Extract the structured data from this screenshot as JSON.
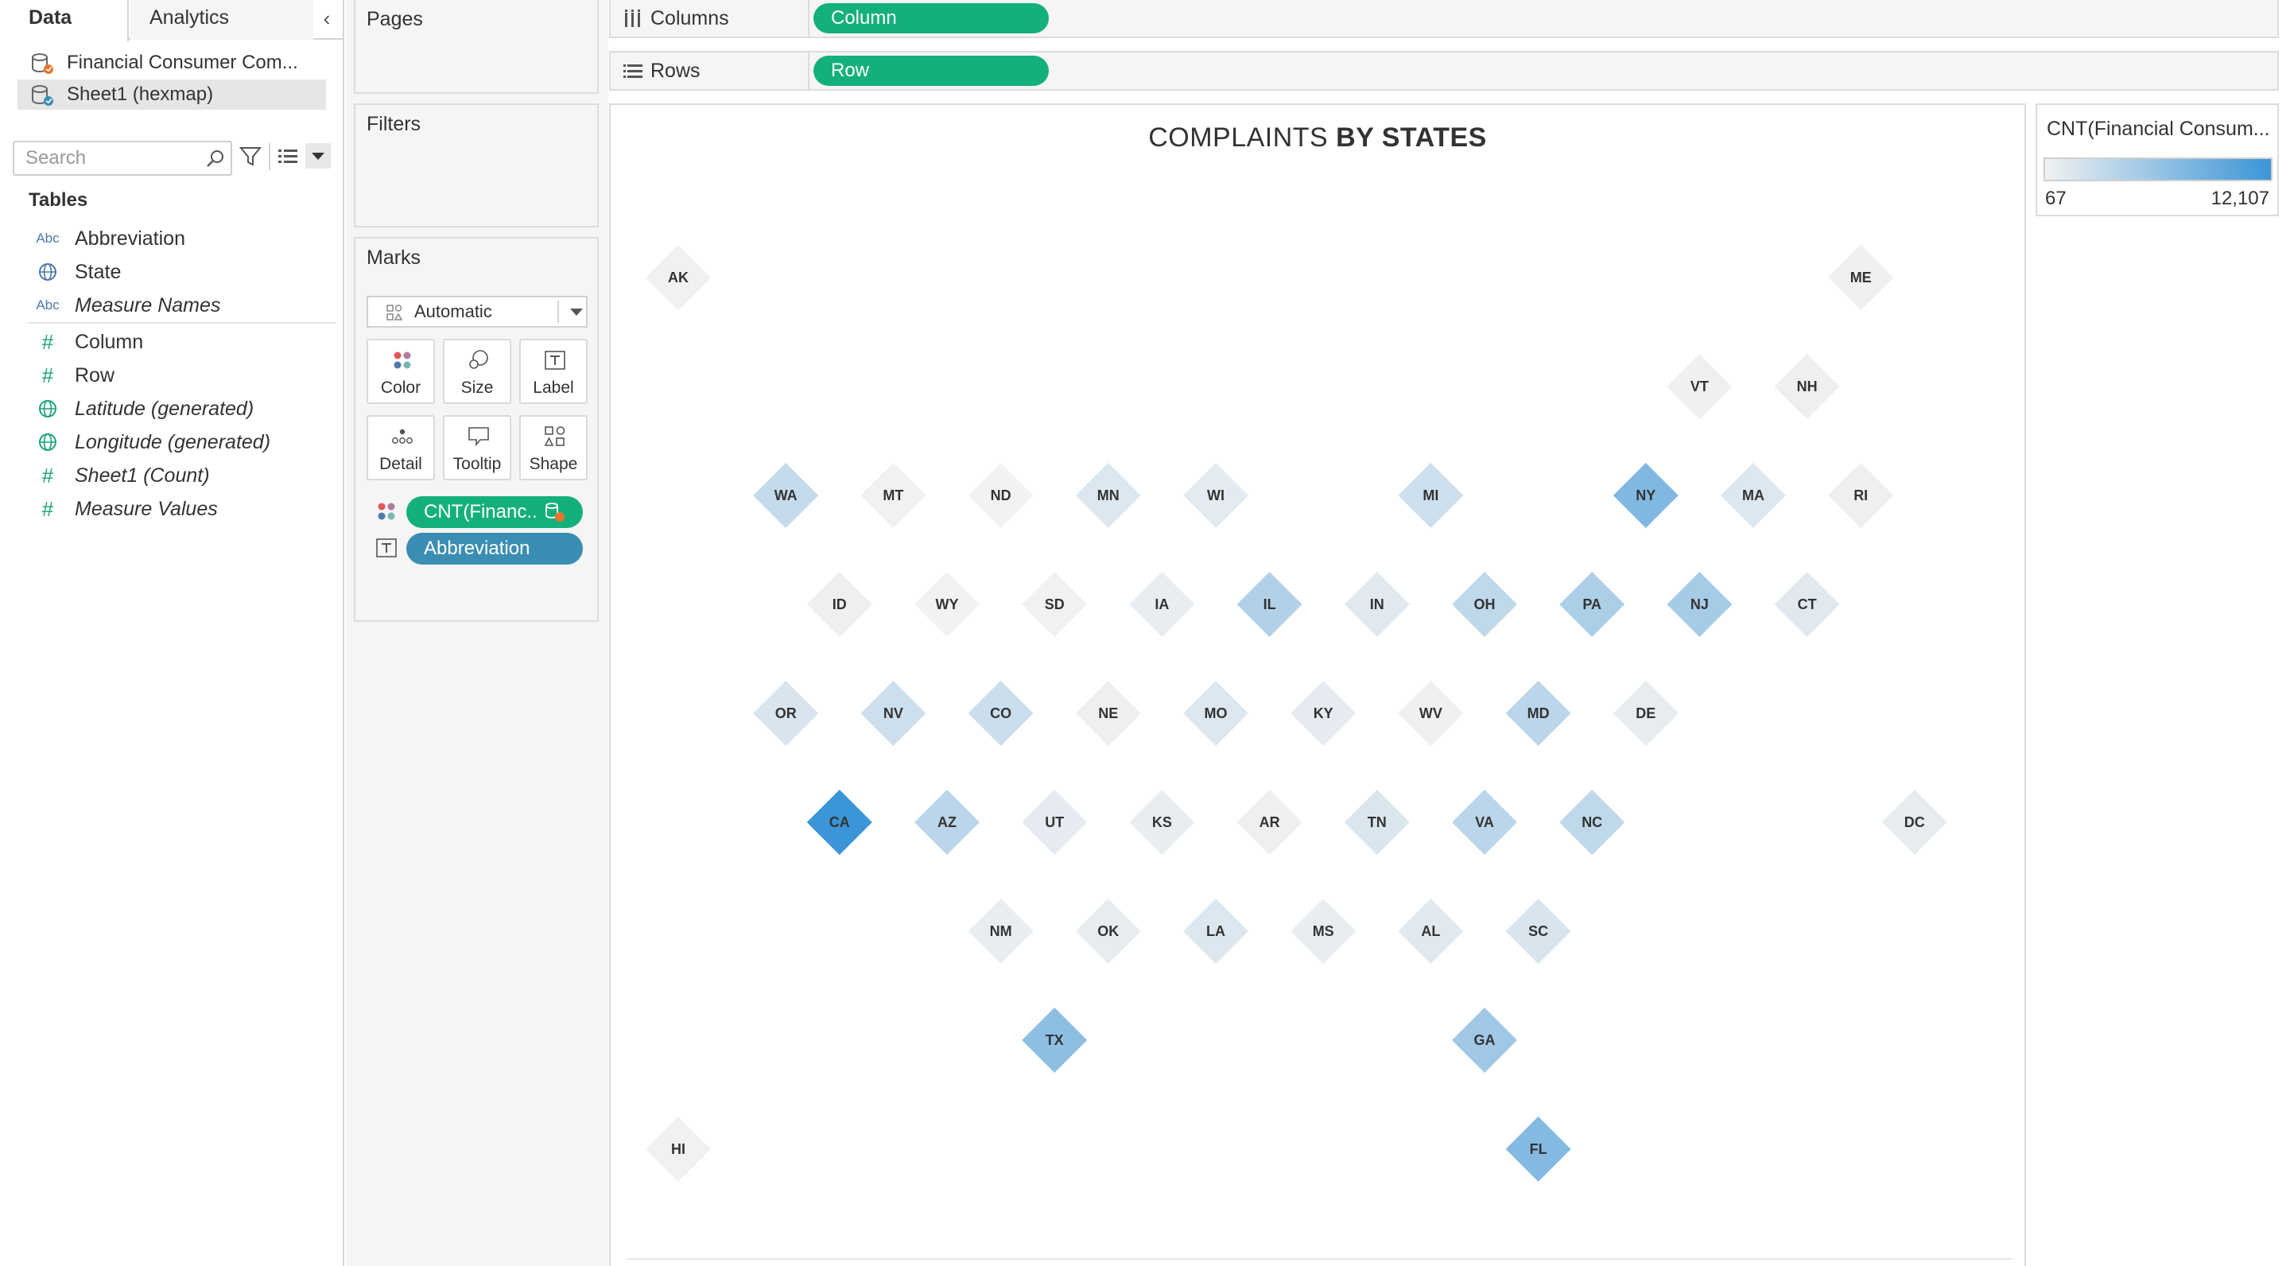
{
  "tabs": {
    "data": "Data",
    "analytics": "Analytics"
  },
  "datasources": [
    {
      "label": "Financial Consumer Com..."
    },
    {
      "label": "Sheet1 (hexmap)"
    }
  ],
  "search": {
    "placeholder": "Search"
  },
  "tables_heading": "Tables",
  "fields": [
    {
      "label": "Abbreviation",
      "icon": "abc-icon",
      "italic": false
    },
    {
      "label": "State",
      "icon": "globe-icon",
      "italic": false
    },
    {
      "label": "Measure Names",
      "icon": "abc-icon",
      "italic": true
    },
    {
      "label": "Column",
      "icon": "hash-icon",
      "italic": false
    },
    {
      "label": "Row",
      "icon": "hash-icon",
      "italic": false
    },
    {
      "label": "Latitude (generated)",
      "icon": "globe-icon",
      "italic": true
    },
    {
      "label": "Longitude (generated)",
      "icon": "globe-icon",
      "italic": true
    },
    {
      "label": "Sheet1 (Count)",
      "icon": "hash-icon",
      "italic": true
    },
    {
      "label": "Measure Values",
      "icon": "hash-icon",
      "italic": true
    }
  ],
  "cards": {
    "pages": "Pages",
    "filters": "Filters",
    "marks": "Marks"
  },
  "marks": {
    "type": "Automatic",
    "buttons": {
      "color": "Color",
      "size": "Size",
      "label": "Label",
      "detail": "Detail",
      "tooltip": "Tooltip",
      "shape": "Shape"
    },
    "pills": {
      "color_pill": "CNT(Financ..",
      "label_pill": "Abbreviation"
    }
  },
  "shelves": {
    "columns_label": "Columns",
    "columns_pill": "Column",
    "rows_label": "Rows",
    "rows_pill": "Row"
  },
  "viz": {
    "title_light": "COMPLAINTS ",
    "title_bold": "BY STATES"
  },
  "legend": {
    "title": "CNT(Financial Consum...",
    "min_label": "67",
    "max_label": "12,107",
    "min": 67,
    "max": 12107,
    "color_low": "#f2f2f2",
    "color_high": "#3b95d7"
  },
  "colors": {
    "accent_green": "#14b07a",
    "accent_blue": "#3b8eb3"
  },
  "chart_data": {
    "type": "heatmap",
    "title": "COMPLAINTS BY STATES",
    "mark_shape": "diamond",
    "series": [
      {
        "state": "AK",
        "column": 1,
        "row": 1,
        "intensity": 0.01
      },
      {
        "state": "ME",
        "column": 12,
        "row": 1,
        "intensity": 0.02
      },
      {
        "state": "VT",
        "column": 10.5,
        "row": 2,
        "intensity": 0.02
      },
      {
        "state": "NH",
        "column": 11.5,
        "row": 2,
        "intensity": 0.03
      },
      {
        "state": "WA",
        "column": 2,
        "row": 3,
        "intensity": 0.25
      },
      {
        "state": "MT",
        "column": 3,
        "row": 3,
        "intensity": 0.01
      },
      {
        "state": "ND",
        "column": 4,
        "row": 3,
        "intensity": 0.0
      },
      {
        "state": "MN",
        "column": 5,
        "row": 3,
        "intensity": 0.12
      },
      {
        "state": "WI",
        "column": 6,
        "row": 3,
        "intensity": 0.08
      },
      {
        "state": "MI",
        "column": 8,
        "row": 3,
        "intensity": 0.2
      },
      {
        "state": "NY",
        "column": 10,
        "row": 3,
        "intensity": 0.62
      },
      {
        "state": "MA",
        "column": 11,
        "row": 3,
        "intensity": 0.12
      },
      {
        "state": "RI",
        "column": 12,
        "row": 3,
        "intensity": 0.03
      },
      {
        "state": "ID",
        "column": 2.5,
        "row": 4,
        "intensity": 0.03
      },
      {
        "state": "WY",
        "column": 3.5,
        "row": 4,
        "intensity": 0.0
      },
      {
        "state": "SD",
        "column": 4.5,
        "row": 4,
        "intensity": 0.01
      },
      {
        "state": "IA",
        "column": 5.5,
        "row": 4,
        "intensity": 0.05
      },
      {
        "state": "IL",
        "column": 6.5,
        "row": 4,
        "intensity": 0.35
      },
      {
        "state": "IN",
        "column": 7.5,
        "row": 4,
        "intensity": 0.1
      },
      {
        "state": "OH",
        "column": 8.5,
        "row": 4,
        "intensity": 0.28
      },
      {
        "state": "PA",
        "column": 9.5,
        "row": 4,
        "intensity": 0.38
      },
      {
        "state": "NJ",
        "column": 10.5,
        "row": 4,
        "intensity": 0.42
      },
      {
        "state": "CT",
        "column": 11.5,
        "row": 4,
        "intensity": 0.1
      },
      {
        "state": "OR",
        "column": 2,
        "row": 5,
        "intensity": 0.14
      },
      {
        "state": "NV",
        "column": 3,
        "row": 5,
        "intensity": 0.2
      },
      {
        "state": "CO",
        "column": 4,
        "row": 5,
        "intensity": 0.22
      },
      {
        "state": "NE",
        "column": 5,
        "row": 5,
        "intensity": 0.03
      },
      {
        "state": "MO",
        "column": 6,
        "row": 5,
        "intensity": 0.12
      },
      {
        "state": "KY",
        "column": 7,
        "row": 5,
        "intensity": 0.07
      },
      {
        "state": "WV",
        "column": 8,
        "row": 5,
        "intensity": 0.02
      },
      {
        "state": "MD",
        "column": 9,
        "row": 5,
        "intensity": 0.3
      },
      {
        "state": "DE",
        "column": 10,
        "row": 5,
        "intensity": 0.06
      },
      {
        "state": "CA",
        "column": 2.5,
        "row": 6,
        "intensity": 1.0
      },
      {
        "state": "AZ",
        "column": 3.5,
        "row": 6,
        "intensity": 0.3
      },
      {
        "state": "UT",
        "column": 4.5,
        "row": 6,
        "intensity": 0.07
      },
      {
        "state": "KS",
        "column": 5.5,
        "row": 6,
        "intensity": 0.05
      },
      {
        "state": "AR",
        "column": 6.5,
        "row": 6,
        "intensity": 0.03
      },
      {
        "state": "TN",
        "column": 7.5,
        "row": 6,
        "intensity": 0.13
      },
      {
        "state": "VA",
        "column": 8.5,
        "row": 6,
        "intensity": 0.3
      },
      {
        "state": "NC",
        "column": 9.5,
        "row": 6,
        "intensity": 0.28
      },
      {
        "state": "DC",
        "column": 12.5,
        "row": 6,
        "intensity": 0.06
      },
      {
        "state": "NM",
        "column": 4,
        "row": 7,
        "intensity": 0.05
      },
      {
        "state": "OK",
        "column": 5,
        "row": 7,
        "intensity": 0.06
      },
      {
        "state": "LA",
        "column": 6,
        "row": 7,
        "intensity": 0.12
      },
      {
        "state": "MS",
        "column": 7,
        "row": 7,
        "intensity": 0.05
      },
      {
        "state": "AL",
        "column": 8,
        "row": 7,
        "intensity": 0.1
      },
      {
        "state": "SC",
        "column": 9,
        "row": 7,
        "intensity": 0.14
      },
      {
        "state": "TX",
        "column": 4.5,
        "row": 8,
        "intensity": 0.55
      },
      {
        "state": "GA",
        "column": 8.5,
        "row": 8,
        "intensity": 0.45
      },
      {
        "state": "HI",
        "column": 1,
        "row": 9,
        "intensity": 0.01
      },
      {
        "state": "FL",
        "column": 9,
        "row": 9,
        "intensity": 0.6
      }
    ]
  }
}
